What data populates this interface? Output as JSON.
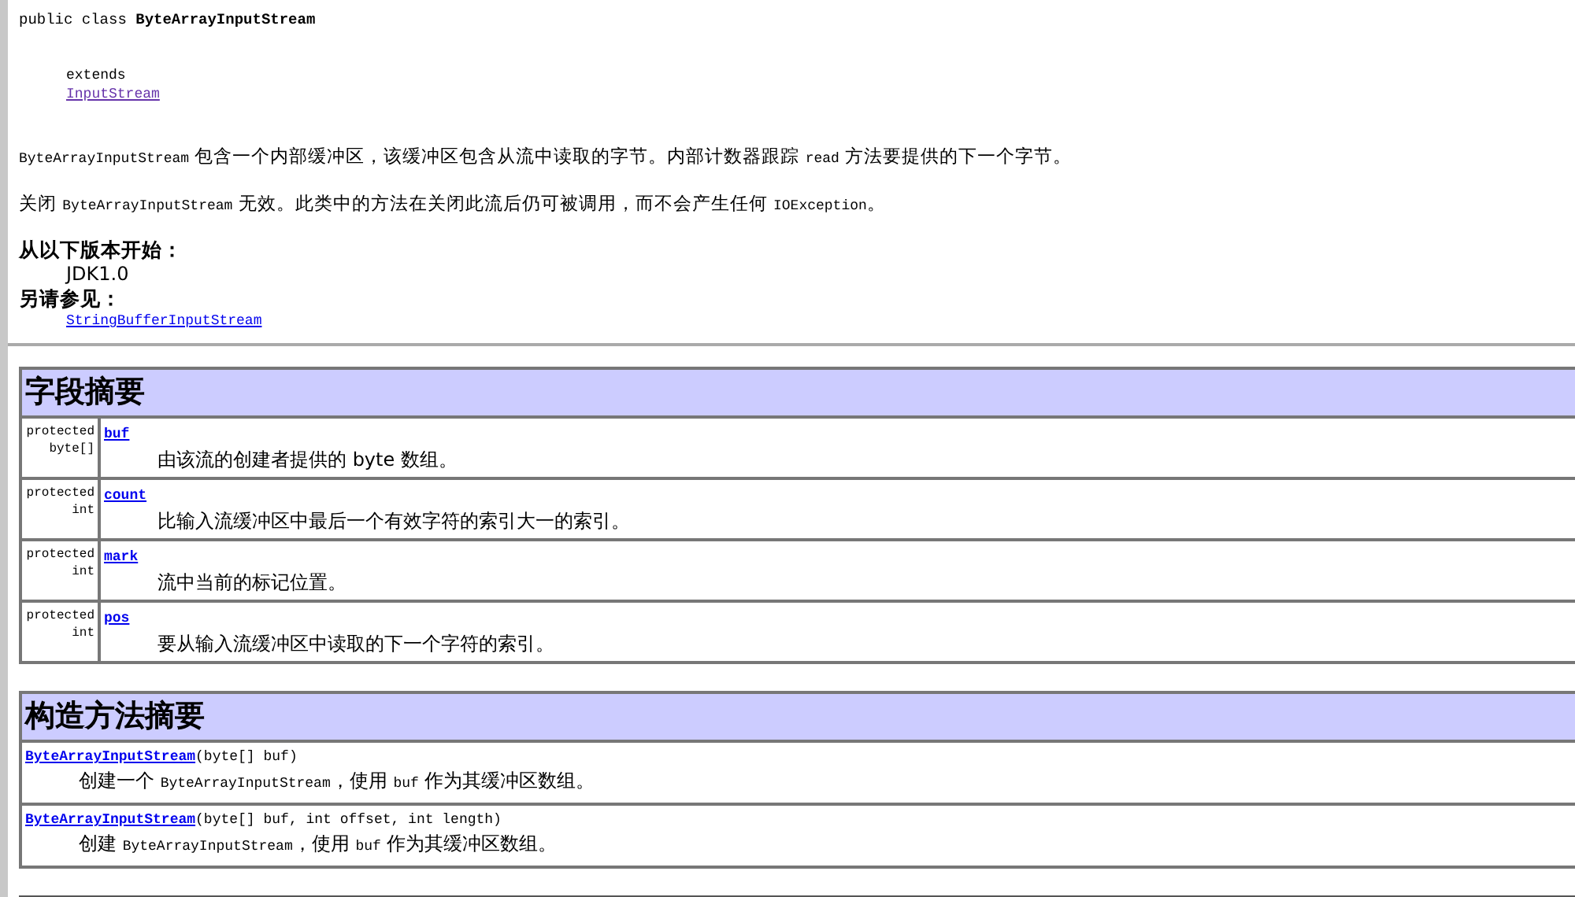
{
  "class_signature": {
    "prefix": "public class ",
    "name": "ByteArrayInputStream"
  },
  "extends": {
    "keyword": "extends",
    "parent": "InputStream"
  },
  "description": [
    [
      {
        "kind": "code",
        "text": "ByteArrayInputStream"
      },
      {
        "kind": "text",
        "text": " 包含一个内部缓冲区，该缓冲区包含从流中读取的字节。内部计数器跟踪 "
      },
      {
        "kind": "code",
        "text": "read"
      },
      {
        "kind": "text",
        "text": " 方法要提供的下一个字节。"
      }
    ],
    [
      {
        "kind": "text",
        "text": "关闭 "
      },
      {
        "kind": "code",
        "text": "ByteArrayInputStream"
      },
      {
        "kind": "text",
        "text": " 无效。此类中的方法在关闭此流后仍可被调用，而不会产生任何 "
      },
      {
        "kind": "code",
        "text": "IOException"
      },
      {
        "kind": "text",
        "text": "。"
      }
    ]
  ],
  "since": {
    "label": "从以下版本开始：",
    "value": "JDK1.0"
  },
  "see_also": {
    "label": "另请参见：",
    "link": "StringBufferInputStream"
  },
  "field_summary": {
    "title": "字段摘要",
    "rows": [
      {
        "modifier": "protected",
        "type": "byte[]",
        "name": "buf",
        "description": "由该流的创建者提供的 byte 数组。"
      },
      {
        "modifier": "protected",
        "type": "int",
        "name": "count",
        "description": "比输入流缓冲区中最后一个有效字符的索引大一的索引。"
      },
      {
        "modifier": "protected",
        "type": "int",
        "name": "mark",
        "description": "流中当前的标记位置。"
      },
      {
        "modifier": "protected",
        "type": "int",
        "name": "pos",
        "description": "要从输入流缓冲区中读取的下一个字符的索引。"
      }
    ]
  },
  "constructor_summary": {
    "title": "构造方法摘要",
    "rows": [
      {
        "name": "ByteArrayInputStream",
        "params": "(byte[]  buf)",
        "description": [
          {
            "kind": "text",
            "text": "创建一个 "
          },
          {
            "kind": "code",
            "text": "ByteArrayInputStream"
          },
          {
            "kind": "text",
            "text": "，使用 "
          },
          {
            "kind": "code",
            "text": "buf"
          },
          {
            "kind": "text",
            "text": " 作为其缓冲区数组。"
          }
        ]
      },
      {
        "name": "ByteArrayInputStream",
        "params": "(byte[]  buf, int  offset, int  length)",
        "description": [
          {
            "kind": "text",
            "text": "创建 "
          },
          {
            "kind": "code",
            "text": "ByteArrayInputStream"
          },
          {
            "kind": "text",
            "text": "，使用 "
          },
          {
            "kind": "code",
            "text": "buf"
          },
          {
            "kind": "text",
            "text": " 作为其缓冲区数组。"
          }
        ]
      }
    ]
  }
}
